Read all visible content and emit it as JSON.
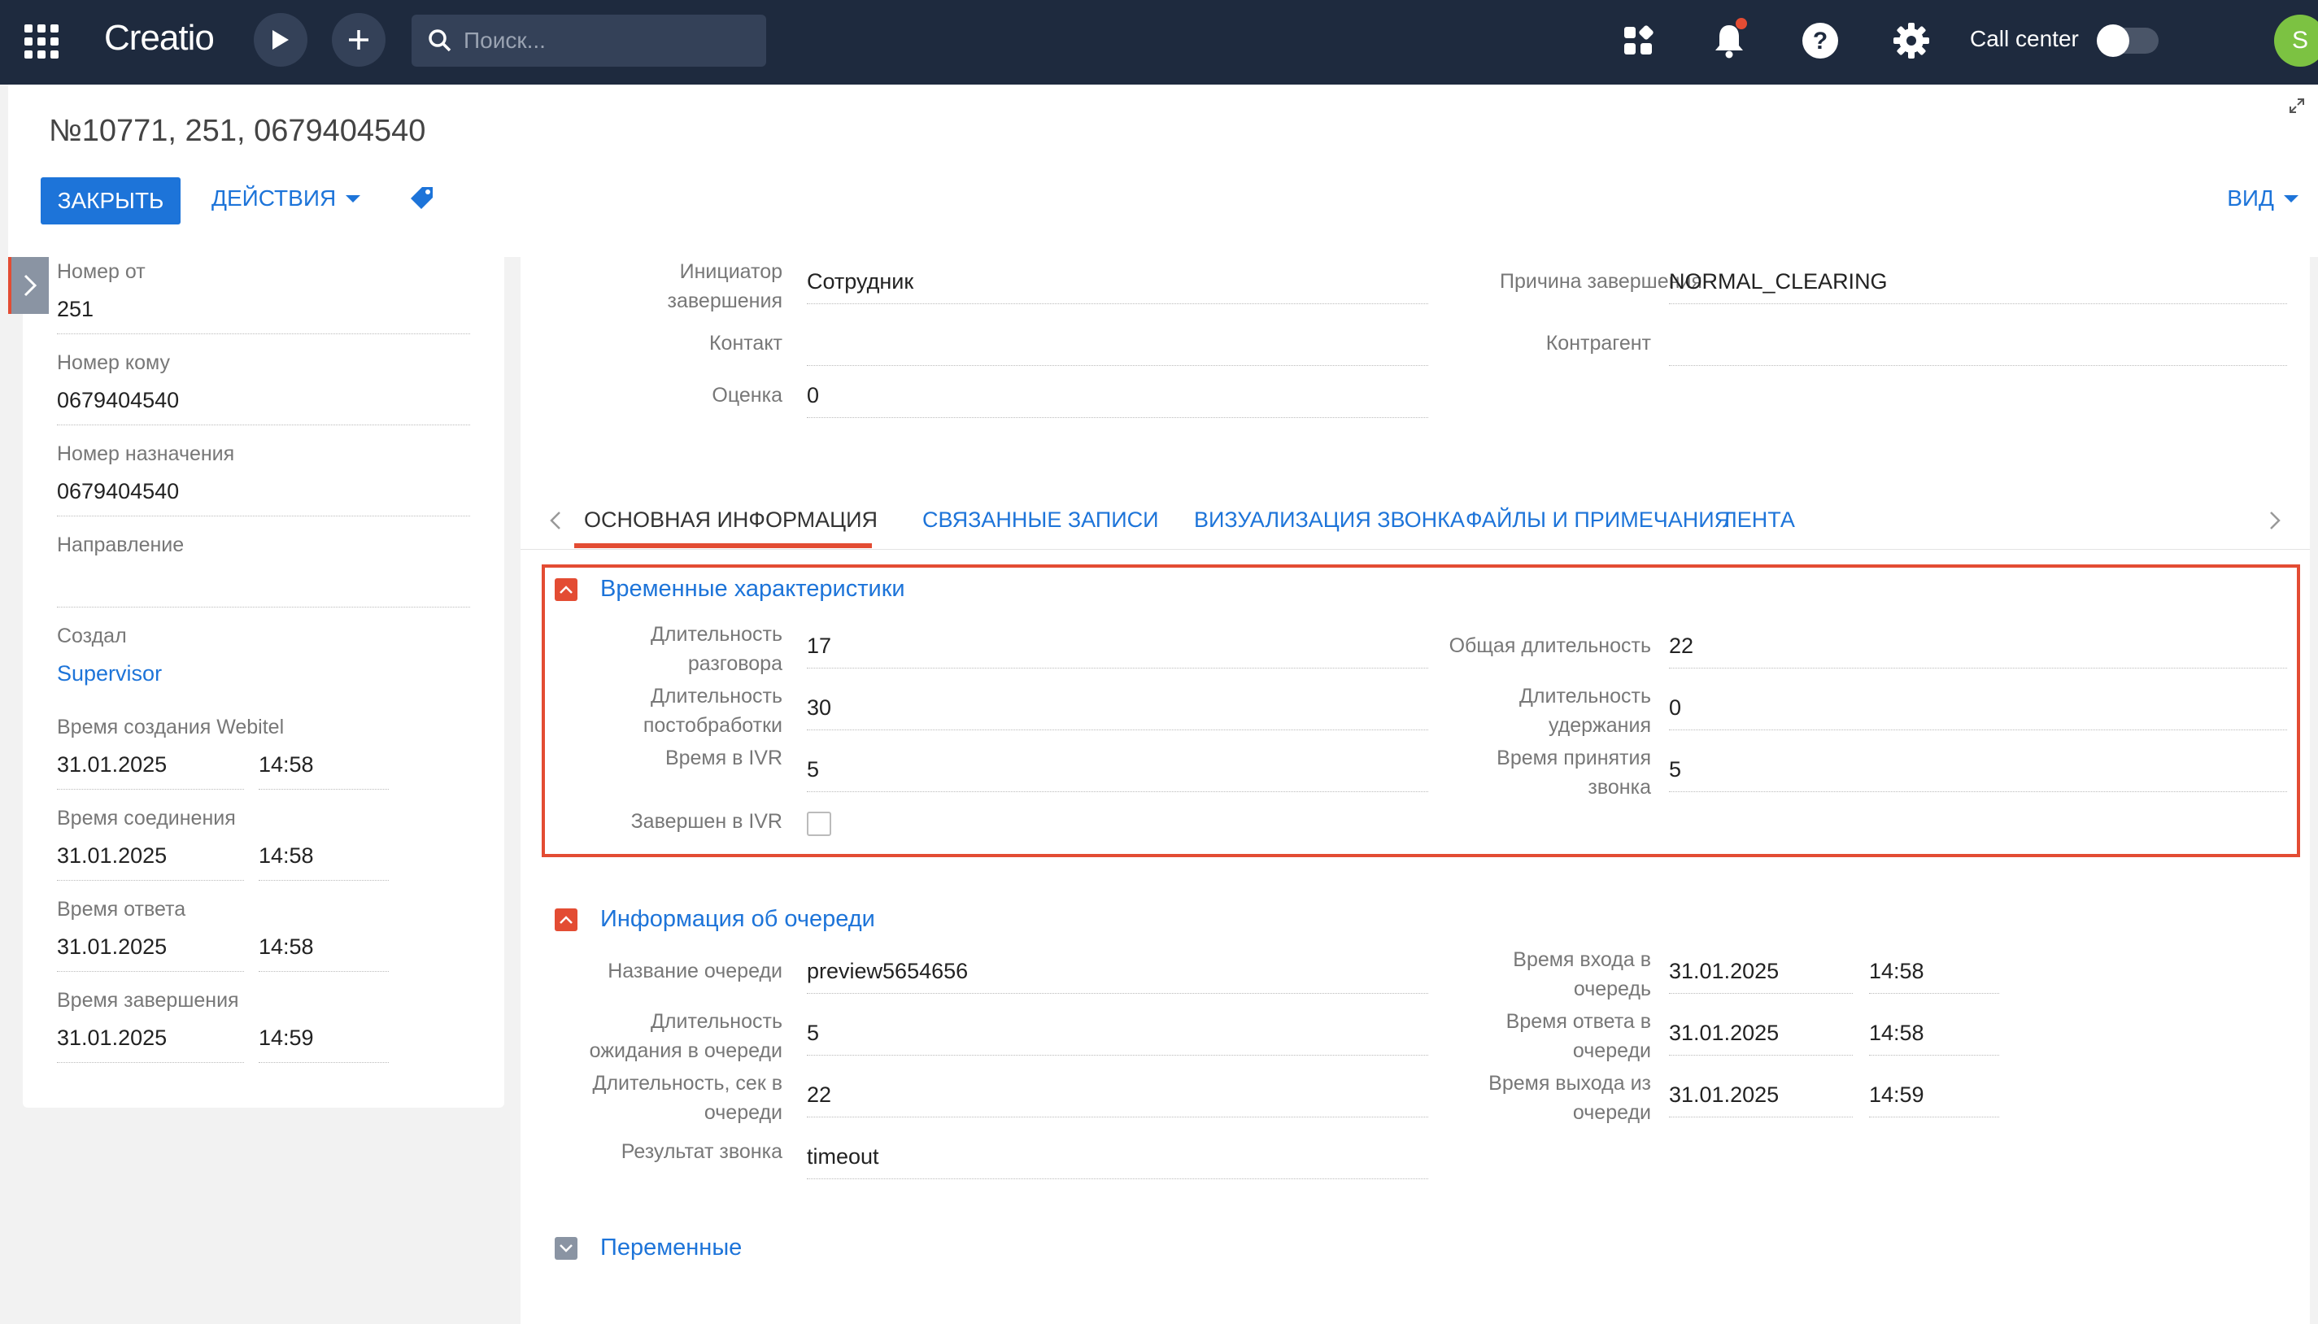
{
  "topbar": {
    "logo": "Creatio",
    "search_placeholder": "Поиск...",
    "callcenter_label": "Call center",
    "avatar_initial": "S",
    "colors": {
      "bar": "#1e2a3e",
      "accent": "#1d74d9",
      "alert": "#e34c33"
    }
  },
  "header": {
    "title": "№10771, 251, 0679404540",
    "close_label": "ЗАКРЫТЬ",
    "actions_label": "ДЕЙСТВИЯ",
    "view_label": "ВИД"
  },
  "left": {
    "from_label": "Номер от",
    "from_value": "251",
    "to_label": "Номер кому",
    "to_value": "0679404540",
    "dest_label": "Номер назначения",
    "dest_value": "0679404540",
    "direction_label": "Направление",
    "direction_value": "",
    "created_by_label": "Создал",
    "created_by_value": "Supervisor",
    "created_time_label": "Время создания Webitel",
    "created_date": "31.01.2025",
    "created_time": "14:58",
    "connect_label": "Время соединения",
    "connect_date": "31.01.2025",
    "connect_time": "14:58",
    "answer_label": "Время ответа",
    "answer_date": "31.01.2025",
    "answer_time": "14:58",
    "end_label": "Время завершения",
    "end_date": "31.01.2025",
    "end_time": "14:59"
  },
  "top_card": {
    "initiator_label_1": "Инициатор",
    "initiator_label_2": "завершения",
    "initiator_value": "Сотрудник",
    "reason_label": "Причина завершения",
    "reason_value": "NORMAL_CLEARING",
    "contact_label": "Контакт",
    "contact_value": "",
    "account_label": "Контрагент",
    "account_value": "",
    "rating_label": "Оценка",
    "rating_value": "0"
  },
  "tabs": [
    {
      "label": "ОСНОВНАЯ ИНФОРМАЦИЯ",
      "active": true
    },
    {
      "label": "СВЯЗАННЫЕ ЗАПИСИ",
      "active": false
    },
    {
      "label": "ВИЗУАЛИЗАЦИЯ ЗВОНКА",
      "active": false
    },
    {
      "label": "ФАЙЛЫ И ПРИМЕЧАНИЯ",
      "active": false
    },
    {
      "label": "ЛЕНТА",
      "active": false
    }
  ],
  "time_section": {
    "title": "Временные характеристики",
    "talk_label_1": "Длительность",
    "talk_label_2": "разговора",
    "talk_value": "17",
    "total_label": "Общая длительность",
    "total_value": "22",
    "post_label_1": "Длительность",
    "post_label_2": "постобработки",
    "post_value": "30",
    "hold_label_1": "Длительность",
    "hold_label_2": "удержания",
    "hold_value": "0",
    "ivr_label": "Время в IVR",
    "ivr_value": "5",
    "accept_label_1": "Время принятия",
    "accept_label_2": "звонка",
    "accept_value": "5",
    "ivr_done_label": "Завершен в IVR",
    "ivr_done_checked": false
  },
  "queue_section": {
    "title": "Информация об очереди",
    "name_label": "Название очереди",
    "name_value": "preview5654656",
    "enter_label_1": "Время входа в",
    "enter_label_2": "очередь",
    "enter_date": "31.01.2025",
    "enter_time": "14:58",
    "wait_label_1": "Длительность",
    "wait_label_2": "ожидания в очереди",
    "wait_value": "5",
    "answer_label_1": "Время ответа в",
    "answer_label_2": "очереди",
    "answer_date": "31.01.2025",
    "answer_time": "14:58",
    "sec_label_1": "Длительность, сек в",
    "sec_label_2": "очереди",
    "sec_value": "22",
    "exit_label_1": "Время выхода из",
    "exit_label_2": "очереди",
    "exit_date": "31.01.2025",
    "exit_time": "14:59",
    "result_label": "Результат звонка",
    "result_value": "timeout"
  },
  "variables_section": {
    "title": "Переменные"
  }
}
